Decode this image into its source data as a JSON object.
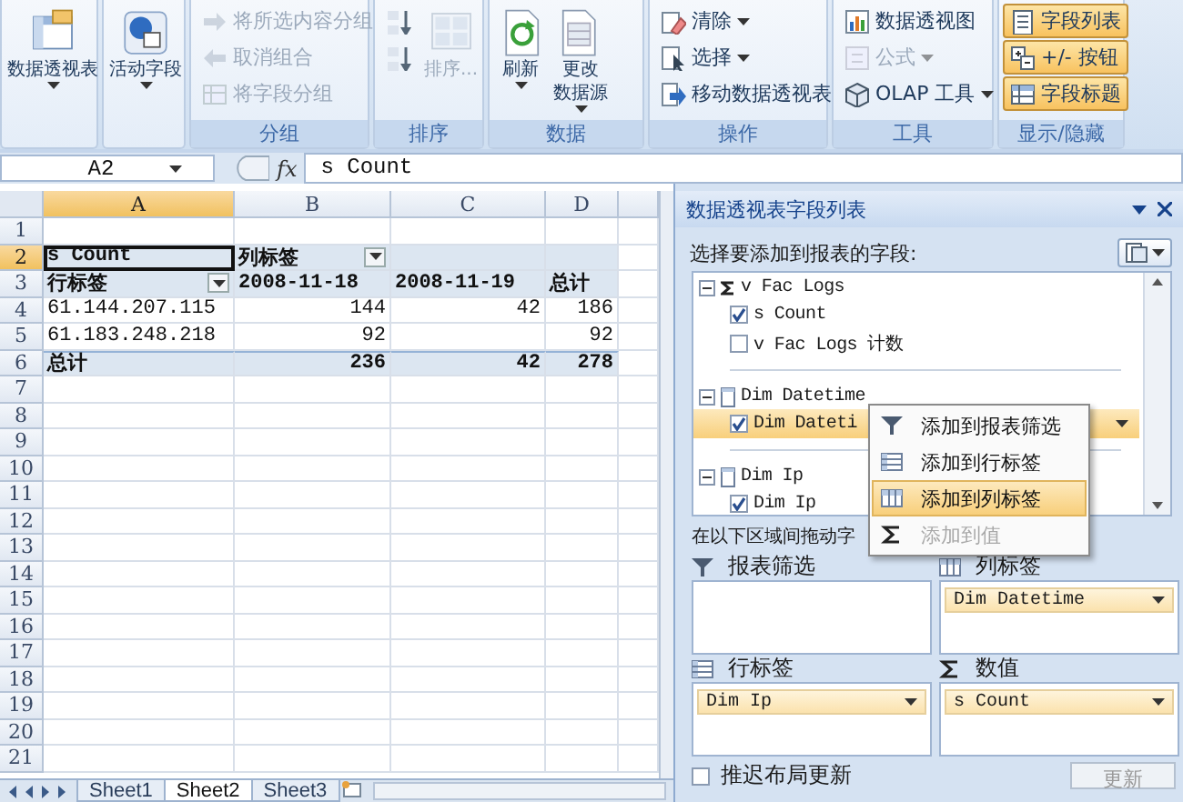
{
  "ribbon": {
    "groups": [
      {
        "buttons": [
          {
            "label": "数据透视表",
            "kind": "large",
            "dropdown": true,
            "disabled": false,
            "selected": false
          }
        ]
      },
      {
        "buttons": [
          {
            "label": "活动字段",
            "kind": "large",
            "dropdown": true,
            "disabled": false,
            "selected": false
          }
        ]
      },
      {
        "label": "分组",
        "buttons": [
          {
            "label": "将所选内容分组",
            "kind": "small",
            "dropdown": false,
            "disabled": true,
            "selected": false
          },
          {
            "label": "取消组合",
            "kind": "small",
            "dropdown": false,
            "disabled": true,
            "selected": false
          },
          {
            "label": "将字段分组",
            "kind": "small",
            "dropdown": false,
            "disabled": true,
            "selected": false
          }
        ]
      },
      {
        "label": "排序",
        "buttons": [
          {
            "kind": "icon",
            "dropdown": false,
            "disabled": false,
            "selected": false
          },
          {
            "kind": "icon",
            "dropdown": false,
            "disabled": false,
            "selected": false
          },
          {
            "label": "排序...",
            "kind": "large",
            "dropdown": false,
            "disabled": true,
            "selected": false
          }
        ]
      },
      {
        "label": "数据",
        "buttons": [
          {
            "label": "刷新",
            "kind": "large",
            "dropdown": true,
            "disabled": false,
            "selected": false
          },
          {
            "label": [
              "更改",
              "数据源"
            ],
            "kind": "large",
            "dropdown": true,
            "disabled": false,
            "selected": false
          }
        ]
      },
      {
        "label": "操作",
        "buttons": [
          {
            "label": "清除",
            "kind": "small",
            "dropdown": true,
            "disabled": false,
            "selected": false
          },
          {
            "label": "选择",
            "kind": "small",
            "dropdown": true,
            "disabled": false,
            "selected": false
          },
          {
            "label": "移动数据透视表",
            "kind": "small",
            "dropdown": false,
            "disabled": false,
            "selected": false
          }
        ]
      },
      {
        "label": "工具",
        "buttons": [
          {
            "label": "数据透视图",
            "kind": "small",
            "dropdown": false,
            "disabled": false,
            "selected": false
          },
          {
            "label": "公式",
            "kind": "small",
            "dropdown": true,
            "disabled": true,
            "selected": false
          },
          {
            "label": "OLAP 工具",
            "kind": "small",
            "dropdown": true,
            "disabled": false,
            "selected": false
          }
        ]
      },
      {
        "label": "显示/隐藏",
        "buttons": [
          {
            "label": "字段列表",
            "kind": "small",
            "dropdown": false,
            "disabled": false,
            "selected": true
          },
          {
            "label": "+/- 按钮",
            "kind": "small",
            "dropdown": false,
            "disabled": false,
            "selected": true
          },
          {
            "label": "字段标题",
            "kind": "small",
            "dropdown": false,
            "disabled": false,
            "selected": true
          }
        ]
      }
    ]
  },
  "formula_bar": {
    "name_box": "A2",
    "function_label": "fx",
    "formula": "s Count"
  },
  "sheet": {
    "columns": [
      {
        "label": "A",
        "selected": true
      },
      {
        "label": "B",
        "selected": false
      },
      {
        "label": "C",
        "selected": false
      },
      {
        "label": "D",
        "selected": false
      },
      {
        "selected": false
      }
    ],
    "rows": [
      {
        "number": "1",
        "kind": "empty",
        "selected": false
      },
      {
        "number": "2",
        "kind": "pivot-header",
        "selected": true,
        "cells": {
          "A": {
            "text": "s Count",
            "selected": true
          },
          "B": {
            "text": "列标签",
            "filter": true,
            "selected": false
          }
        }
      },
      {
        "number": "3",
        "kind": "pivot-header",
        "selected": false,
        "cells": {
          "A": {
            "text": "行标签",
            "filter": true,
            "selected": false
          },
          "B": {
            "text": "2008-11-18",
            "selected": false
          },
          "C": {
            "text": "2008-11-19",
            "selected": false
          },
          "D": {
            "text": "总计",
            "selected": false
          }
        }
      },
      {
        "number": "4",
        "kind": "pivot-data",
        "selected": false,
        "cells": {
          "A": {
            "text": "61.144.207.115",
            "selected": false
          },
          "B": {
            "text": "144",
            "selected": false
          },
          "C": {
            "text": "42",
            "selected": false
          },
          "D": {
            "text": "186",
            "selected": false
          }
        }
      },
      {
        "number": "5",
        "kind": "pivot-data",
        "selected": false,
        "cells": {
          "A": {
            "text": "61.183.248.218",
            "selected": false
          },
          "B": {
            "text": "92",
            "selected": false
          },
          "D": {
            "text": "92",
            "selected": false
          }
        }
      },
      {
        "number": "6",
        "kind": "pivot-total",
        "selected": false,
        "cells": {
          "A": {
            "text": "总计",
            "selected": false
          },
          "B": {
            "text": "236",
            "selected": false
          },
          "C": {
            "text": "42",
            "selected": false
          },
          "D": {
            "text": "278",
            "selected": false
          }
        }
      },
      {
        "number": "7",
        "kind": "empty",
        "selected": false
      },
      {
        "number": "8",
        "kind": "empty",
        "selected": false
      },
      {
        "number": "9",
        "kind": "empty",
        "selected": false
      },
      {
        "number": "10",
        "kind": "empty",
        "selected": false
      },
      {
        "number": "11",
        "kind": "empty",
        "selected": false
      },
      {
        "number": "12",
        "kind": "empty",
        "selected": false
      },
      {
        "number": "13",
        "kind": "empty",
        "selected": false
      },
      {
        "number": "14",
        "kind": "empty",
        "selected": false
      },
      {
        "number": "15",
        "kind": "empty",
        "selected": false
      },
      {
        "number": "16",
        "kind": "empty",
        "selected": false
      },
      {
        "number": "17",
        "kind": "empty",
        "selected": false
      },
      {
        "number": "18",
        "kind": "empty",
        "selected": false
      },
      {
        "number": "19",
        "kind": "empty",
        "selected": false
      },
      {
        "number": "20",
        "kind": "empty",
        "selected": false
      },
      {
        "number": "21",
        "kind": "empty",
        "selected": false
      }
    ],
    "tabs": [
      {
        "label": "Sheet1",
        "selected": false
      },
      {
        "label": "Sheet2",
        "selected": true
      },
      {
        "label": "Sheet3",
        "selected": false
      }
    ]
  },
  "field_pane": {
    "title": "数据透视表字段列表",
    "prompt": "选择要添加到报表的字段:",
    "fields": [
      {
        "label": "v Fac Logs",
        "kind": "measure",
        "expanded": true,
        "children": [
          {
            "label": "s Count",
            "checked": true,
            "highlighted": false
          },
          {
            "label": "v Fac Logs 计数",
            "checked": false,
            "highlighted": false
          }
        ]
      },
      {
        "label": "Dim Datetime",
        "kind": "dimension",
        "expanded": true,
        "children": [
          {
            "label": "Dim Dateti",
            "checked": true,
            "highlighted": true
          }
        ]
      },
      {
        "label": "Dim Ip",
        "kind": "dimension",
        "expanded": true,
        "children": [
          {
            "label": "Dim Ip",
            "checked": true,
            "highlighted": false
          }
        ]
      }
    ],
    "context_menu": [
      {
        "label": "添加到报表筛选",
        "kind": "filter",
        "selected": false,
        "disabled": false
      },
      {
        "label": "添加到行标签",
        "kind": "rows",
        "selected": false,
        "disabled": false
      },
      {
        "label": "添加到列标签",
        "kind": "columns",
        "selected": true,
        "disabled": false
      },
      {
        "label": "添加到值",
        "kind": "values",
        "selected": false,
        "disabled": true
      }
    ],
    "areas_prompt": "在以下区域间拖动字",
    "areas": [
      {
        "label": "报表筛选",
        "kind": "filter"
      },
      {
        "label": "列标签",
        "kind": "columns",
        "fields": [
          "Dim Datetime"
        ]
      },
      {
        "label": "行标签",
        "kind": "rows",
        "fields": [
          "Dim Ip"
        ]
      },
      {
        "label": "数值",
        "kind": "values",
        "fields": [
          "s Count"
        ]
      }
    ],
    "defer_update": {
      "label": "推迟布局更新",
      "checked": false
    },
    "update_button": {
      "label": "更新",
      "disabled": true
    }
  }
}
